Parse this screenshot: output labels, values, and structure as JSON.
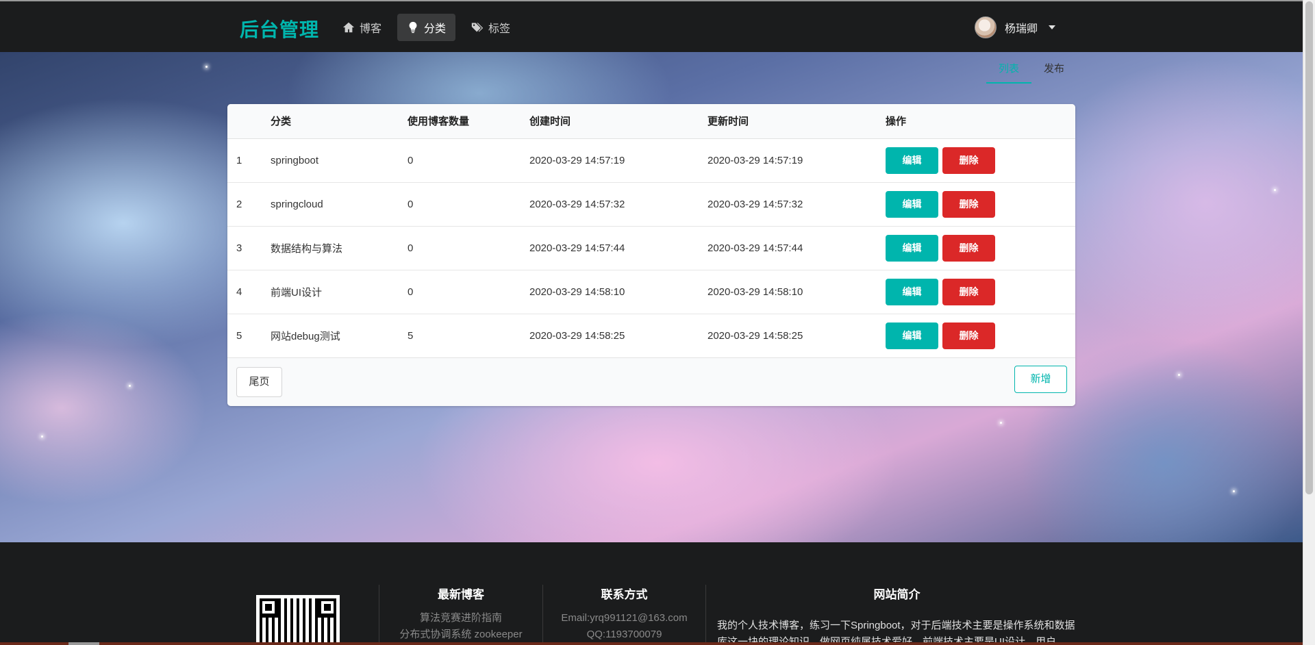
{
  "brand": "后台管理",
  "nav": {
    "items": [
      {
        "label": "博客",
        "icon": "home-icon"
      },
      {
        "label": "分类",
        "icon": "lightbulb-icon"
      },
      {
        "label": "标签",
        "icon": "tags-icon"
      }
    ],
    "active": "分类"
  },
  "user": {
    "name": "杨瑞卿",
    "icon": "caret-down-icon"
  },
  "tabs": [
    {
      "label": "列表"
    },
    {
      "label": "发布"
    }
  ],
  "table": {
    "headers": [
      "",
      "分类",
      "使用博客数量",
      "创建时间",
      "更新时间",
      "操作"
    ],
    "rows": [
      {
        "id": "1",
        "name": "springboot",
        "count": "0",
        "created": "2020-03-29 14:57:19",
        "updated": "2020-03-29 14:57:19"
      },
      {
        "id": "2",
        "name": "springcloud",
        "count": "0",
        "created": "2020-03-29 14:57:32",
        "updated": "2020-03-29 14:57:32"
      },
      {
        "id": "3",
        "name": "数据结构与算法",
        "count": "0",
        "created": "2020-03-29 14:57:44",
        "updated": "2020-03-29 14:57:44"
      },
      {
        "id": "4",
        "name": "前端UI设计",
        "count": "0",
        "created": "2020-03-29 14:58:10",
        "updated": "2020-03-29 14:58:10"
      },
      {
        "id": "5",
        "name": "网站debug测试",
        "count": "5",
        "created": "2020-03-29 14:58:25",
        "updated": "2020-03-29 14:58:25"
      }
    ],
    "edit_label": "编辑",
    "delete_label": "删除"
  },
  "pager": {
    "last_label": "尾页",
    "add_label": "新增"
  },
  "footer": {
    "latest": {
      "title": "最新博客",
      "lines": [
        "算法竞赛进阶指南",
        "分布式协调系统 zookeeper"
      ]
    },
    "contact": {
      "title": "联系方式",
      "lines": [
        "Email:yrq991121@163.com",
        "QQ:1193700079"
      ]
    },
    "about": {
      "title": "网站简介",
      "text": "我的个人技术博客，练习一下Springboot，对于后端技术主要是操作系统和数据库这一块的理论知识，做网页纯属技术爱好，前端技术主要是UI设计，用户"
    }
  },
  "colors": {
    "accent": "#00b5ad",
    "danger": "#db2828",
    "nav_bg": "#1b1c1d"
  }
}
